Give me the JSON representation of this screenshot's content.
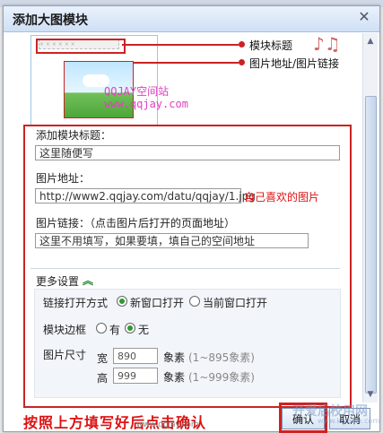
{
  "dialog": {
    "title": "添加大图模块",
    "close_glyph": "✕"
  },
  "preview": {
    "placeholder_title": "× × × × × ×",
    "qq_line1": "QQJAY空间站",
    "qq_line2": "www.qqjay.com"
  },
  "callouts": {
    "module_title": "模块标题",
    "image_link": "图片地址/图片链接"
  },
  "form": {
    "title_label": "添加模块标题：",
    "title_value": "这里随便写",
    "url_label": "图片地址：",
    "url_value": "http://www2.qqjay.com/datu/qqjay/1.jpg",
    "url_note": "自己喜欢的图片",
    "link_label": "图片链接：（点击图片后打开的页面地址）",
    "link_value": "这里不用填写，如果要填，填自己的空间地址",
    "more_label": "更多设置",
    "more_glyph": "︽",
    "open_label": "链接打开方式",
    "open_new": "新窗口打开",
    "open_current": "当前窗口打开",
    "border_label": "模块边框",
    "border_yes": "有",
    "border_no": "无",
    "size_label": "图片尺寸",
    "width_label": "宽",
    "width_value": "890",
    "height_label": "高",
    "height_value": "999",
    "width_unit": "象素",
    "width_hint": "(1~895象素)",
    "height_unit": "象素",
    "height_hint": "(1~999象素)"
  },
  "footer": {
    "instruction": "按照上方填写好后点击确认",
    "ok": "确认",
    "cancel": "取消",
    "watermark": "www.qqjay.com",
    "watermark2": "开爱后校用网",
    "watermark3": "www.kaiaijie.com"
  },
  "colors": {
    "annotation_red": "#cc2222",
    "radio_green": "#2e9a2e"
  }
}
